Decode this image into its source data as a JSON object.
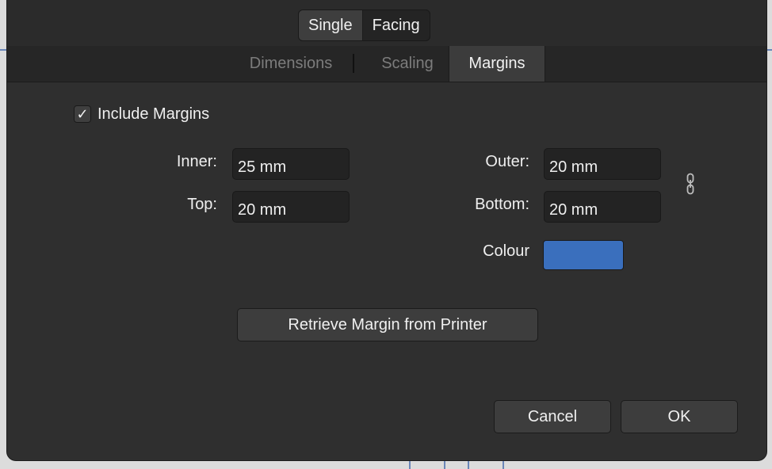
{
  "layout_toggle": {
    "single": "Single",
    "facing": "Facing",
    "selected": "Single"
  },
  "tabs": [
    {
      "label": "Dimensions",
      "active": false
    },
    {
      "label": "Scaling",
      "active": false
    },
    {
      "label": "Margins",
      "active": true
    }
  ],
  "include_margins": {
    "label": "Include Margins",
    "checked": true,
    "mark": "✓"
  },
  "margins": {
    "inner_label": "Inner:",
    "inner_value": "25 mm",
    "top_label": "Top:",
    "top_value": "20 mm",
    "outer_label": "Outer:",
    "outer_value": "20 mm",
    "bottom_label": "Bottom:",
    "bottom_value": "20 mm",
    "link_icon": "chain-link-icon"
  },
  "colour": {
    "label": "Colour",
    "value": "#3a6fbd"
  },
  "retrieve_button": "Retrieve Margin from Printer",
  "footer": {
    "cancel": "Cancel",
    "ok": "OK"
  }
}
